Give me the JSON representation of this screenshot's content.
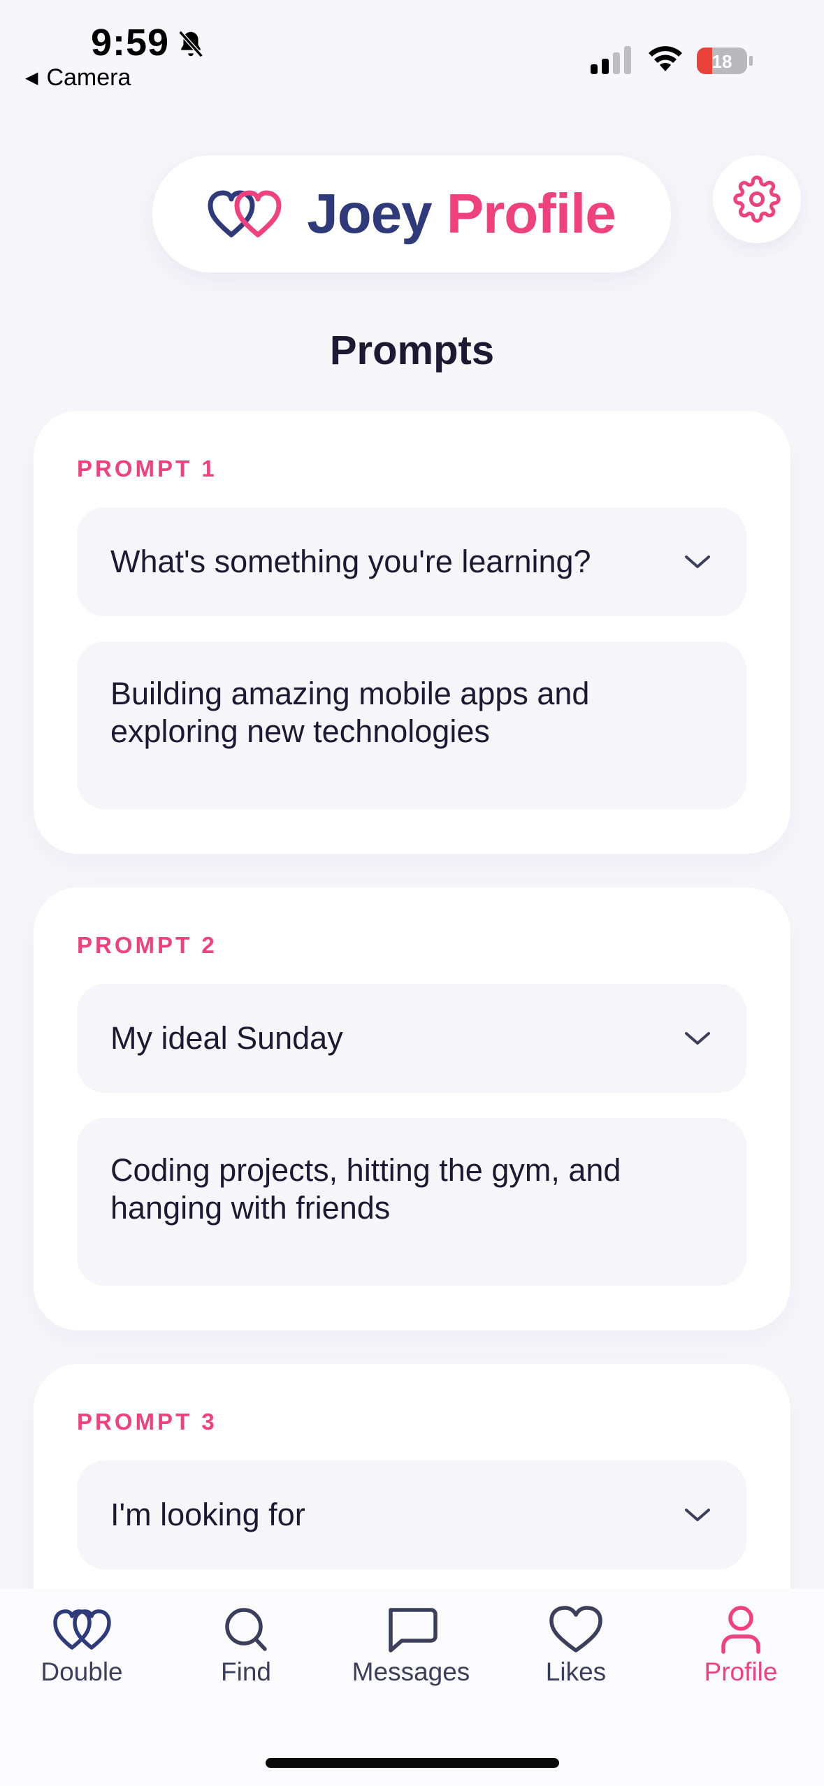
{
  "status_bar": {
    "time": "9:59",
    "back_label": "Camera",
    "battery_level": "18"
  },
  "header": {
    "name": "Joey",
    "page": "Profile",
    "settings_icon": "gear-icon"
  },
  "section_title": "Prompts",
  "prompts": [
    {
      "label": "PROMPT 1",
      "question": "What's something you're learning?",
      "answer": "Building amazing mobile apps and exploring new technologies"
    },
    {
      "label": "PROMPT 2",
      "question": "My ideal Sunday",
      "answer": "Coding projects, hitting the gym, and hanging with friends"
    },
    {
      "label": "PROMPT 3",
      "question": "I'm looking for",
      "answer": ""
    }
  ],
  "nav": {
    "items": [
      {
        "label": "Double",
        "icon": "double-hearts-icon"
      },
      {
        "label": "Find",
        "icon": "search-icon"
      },
      {
        "label": "Messages",
        "icon": "message-icon"
      },
      {
        "label": "Likes",
        "icon": "heart-icon"
      },
      {
        "label": "Profile",
        "icon": "person-icon"
      }
    ],
    "active": "Profile"
  },
  "colors": {
    "accent": "#f0417f",
    "brand_navy": "#2e3a7a",
    "background": "#f7f7fb"
  }
}
